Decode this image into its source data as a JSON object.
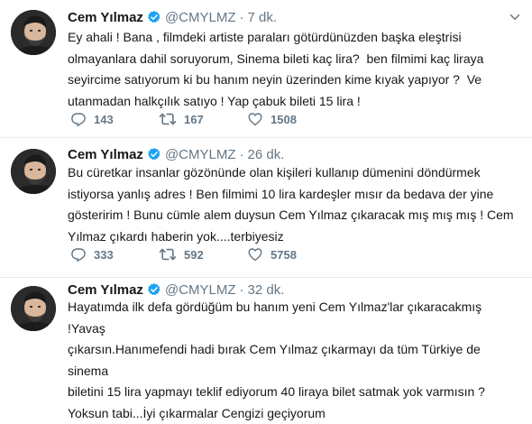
{
  "tweets": [
    {
      "name": "Cem Yılmaz",
      "handle": "@CMYLMZ",
      "time": "7 dk.",
      "text": "Ey ahali ! Bana , filmdeki artiste paraları götürdünüzden başka eleştrisi\nolmayanlara dahil soruyorum, Sinema bileti kaç lira?  ben filmimi kaç liraya\nseyircime satıyorum ki bu hanım neyin üzerinden kime kıyak yapıyor ?  Ve\nutanmadan halkçılık satıyo ! Yap çabuk bileti 15 lira !",
      "replies": "143",
      "retweets": "167",
      "likes": "1508"
    },
    {
      "name": "Cem Yılmaz",
      "handle": "@CMYLMZ",
      "time": "26 dk.",
      "text": "Bu cüretkar insanlar gözönünde olan kişileri kullanıp dümenini döndürmek\nistiyorsa yanlış adres ! Ben filmimi 10 lira kardeşler mısır da bedava der yine\ngösteririm ! Bunu cümle alem duysun Cem Yılmaz çıkaracak mış mış mış ! Cem\nYılmaz çıkardı haberin yok....terbiyesiz",
      "replies": "333",
      "retweets": "592",
      "likes": "5758"
    },
    {
      "name": "Cem Yılmaz",
      "handle": "@CMYLMZ",
      "time": "32 dk.",
      "text": "Hayatımda ilk defa gördüğüm bu hanım yeni Cem Yılmaz'lar çıkaracakmış !Yavaş\nçıkarsın.Hanımefendi hadi bırak Cem Yılmaz çıkarmayı da tüm Türkiye de sinema\nbiletini 15 lira yapmayı teklif ediyorum 40 liraya bilet satmak yok varmısın ?\nYoksun tabi...İyi çıkarmalar Cengizi geçiyorum",
      "replies": "",
      "retweets": "",
      "likes": ""
    }
  ],
  "icons": {
    "reply": "reply-icon",
    "retweet": "retweet-icon",
    "like": "heart-icon",
    "more": "chevron-down-icon",
    "verified": "verified-badge-icon"
  },
  "colors": {
    "text": "#14171a",
    "muted": "#657786",
    "verified": "#1da1f2",
    "separator": "#e6ecf0"
  }
}
